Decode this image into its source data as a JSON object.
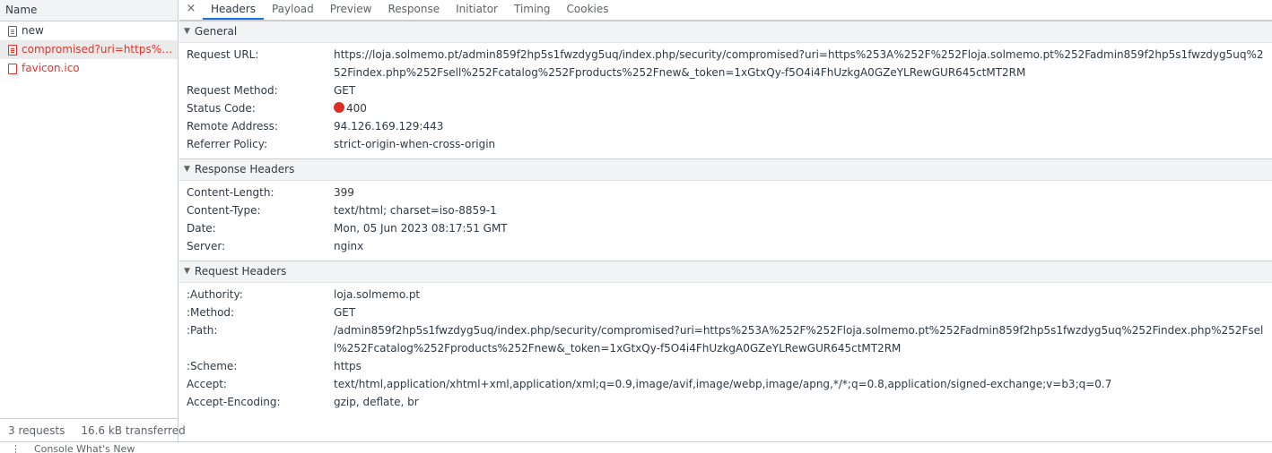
{
  "left": {
    "header": "Name",
    "requests": [
      {
        "label": "new",
        "error": false,
        "selected": false
      },
      {
        "label": "compromised?uri=https%253A%252F%252Floja.solmemo.pt%252Fadmin859f2hp5s1fwzdyg5uq%252Findex.php%252Fsell%252Fcatalog%252Fproducts%252Fnew&_token=1xGtxQy-f5O4i4FhUzkgA0GZeYLRewGUR645ctMT2RM",
        "error": true,
        "selected": true
      },
      {
        "label": "favicon.ico",
        "error": true,
        "selected": false
      }
    ],
    "status": {
      "requests": "3 requests",
      "transferred": "16.6 kB transferred"
    }
  },
  "tabs": {
    "close": "×",
    "items": [
      "Headers",
      "Payload",
      "Preview",
      "Response",
      "Initiator",
      "Timing",
      "Cookies"
    ],
    "active": "Headers"
  },
  "general": {
    "title": "General",
    "request_url_label": "Request URL:",
    "request_url": "https://loja.solmemo.pt/admin859f2hp5s1fwzdyg5uq/index.php/security/compromised?uri=https%253A%252F%252Floja.solmemo.pt%252Fadmin859f2hp5s1fwzdyg5uq%252Findex.php%252Fsell%252Fcatalog%252Fproducts%252Fnew&_token=1xGtxQy-f5O4i4FhUzkgA0GZeYLRewGUR645ctMT2RM",
    "method_label": "Request Method:",
    "method": "GET",
    "status_label": "Status Code:",
    "status": "400",
    "status_color": "#d93025",
    "remote_label": "Remote Address:",
    "remote": "94.126.169.129:443",
    "referrer_label": "Referrer Policy:",
    "referrer": "strict-origin-when-cross-origin"
  },
  "response_headers": {
    "title": "Response Headers",
    "rows": [
      {
        "k": "Content-Length:",
        "v": "399"
      },
      {
        "k": "Content-Type:",
        "v": "text/html; charset=iso-8859-1"
      },
      {
        "k": "Date:",
        "v": "Mon, 05 Jun 2023 08:17:51 GMT"
      },
      {
        "k": "Server:",
        "v": "nginx"
      }
    ]
  },
  "request_headers": {
    "title": "Request Headers",
    "rows": [
      {
        "k": ":Authority:",
        "v": "loja.solmemo.pt"
      },
      {
        "k": ":Method:",
        "v": "GET"
      },
      {
        "k": ":Path:",
        "v": "/admin859f2hp5s1fwzdyg5uq/index.php/security/compromised?uri=https%253A%252F%252Floja.solmemo.pt%252Fadmin859f2hp5s1fwzdyg5uq%252Findex.php%252Fsell%252Fcatalog%252Fproducts%252Fnew&_token=1xGtxQy-f5O4i4FhUzkgA0GZeYLRewGUR645ctMT2RM"
      },
      {
        "k": ":Scheme:",
        "v": "https"
      },
      {
        "k": "Accept:",
        "v": "text/html,application/xhtml+xml,application/xml;q=0.9,image/avif,image/webp,image/apng,*/*;q=0.8,application/signed-exchange;v=b3;q=0.7"
      },
      {
        "k": "Accept-Encoding:",
        "v": "gzip, deflate, br"
      }
    ]
  },
  "bottom": {
    "dots": "⋮",
    "text": "Console   What's New"
  }
}
